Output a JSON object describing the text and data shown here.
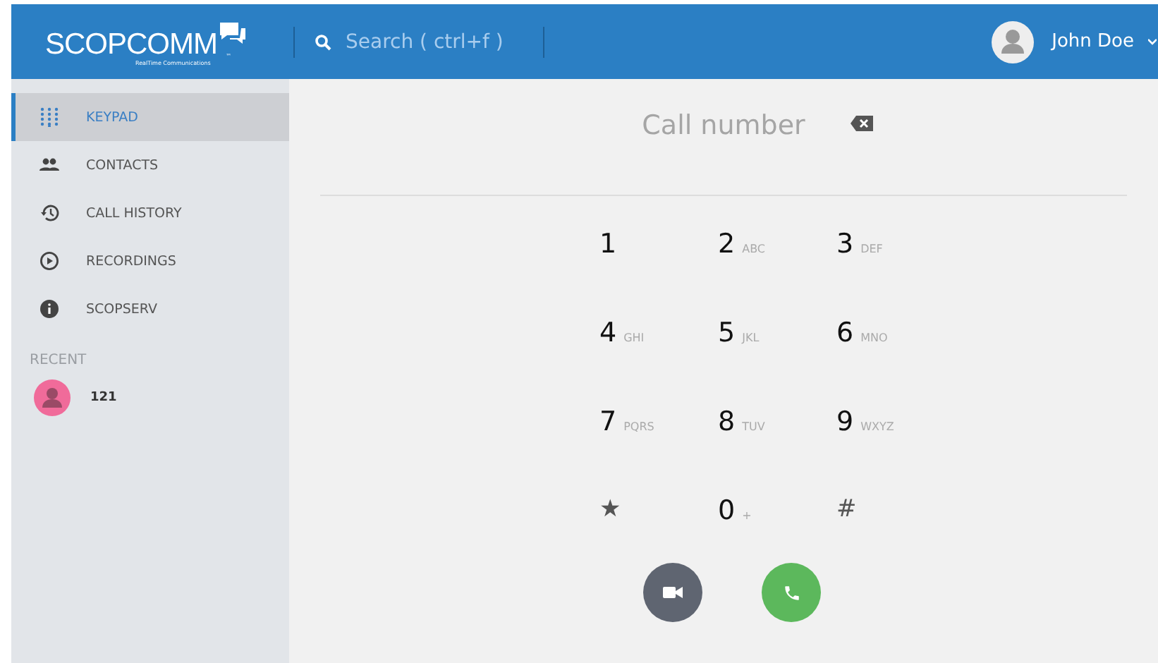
{
  "header": {
    "logo": "SCOPCOMM",
    "logo_tagline": "RealTime Communications",
    "logo_tm": "™",
    "search": {
      "placeholder": "Search ( ctrl+f )"
    },
    "user": {
      "name": "John Doe"
    }
  },
  "sidebar": {
    "items": [
      {
        "label": "KEYPAD",
        "kind": "keypad",
        "selected": true
      },
      {
        "label": "CONTACTS",
        "kind": "contacts",
        "selected": false
      },
      {
        "label": "CALL HISTORY",
        "kind": "history",
        "selected": false
      },
      {
        "label": "RECORDINGS",
        "kind": "play",
        "selected": false
      },
      {
        "label": "SCOPSERV",
        "kind": "info",
        "selected": false
      }
    ],
    "recent_heading": "RECENT",
    "recent": [
      {
        "name": "121",
        "color": "#f06b9a"
      }
    ]
  },
  "dialer": {
    "placeholder": "Call number",
    "keys": [
      {
        "digit": "1"
      },
      {
        "digit": "2",
        "letters": "ABC"
      },
      {
        "digit": "3",
        "letters": "DEF"
      },
      {
        "digit": "4",
        "letters": "GHI"
      },
      {
        "digit": "5",
        "letters": "JKL"
      },
      {
        "digit": "6",
        "letters": "MNO"
      },
      {
        "digit": "7",
        "letters": "PQRS"
      },
      {
        "digit": "8",
        "letters": "TUV"
      },
      {
        "digit": "9",
        "letters": "WXYZ"
      },
      {
        "digit": "★"
      },
      {
        "digit": "0",
        "letters": "+"
      },
      {
        "digit": "#"
      }
    ]
  }
}
